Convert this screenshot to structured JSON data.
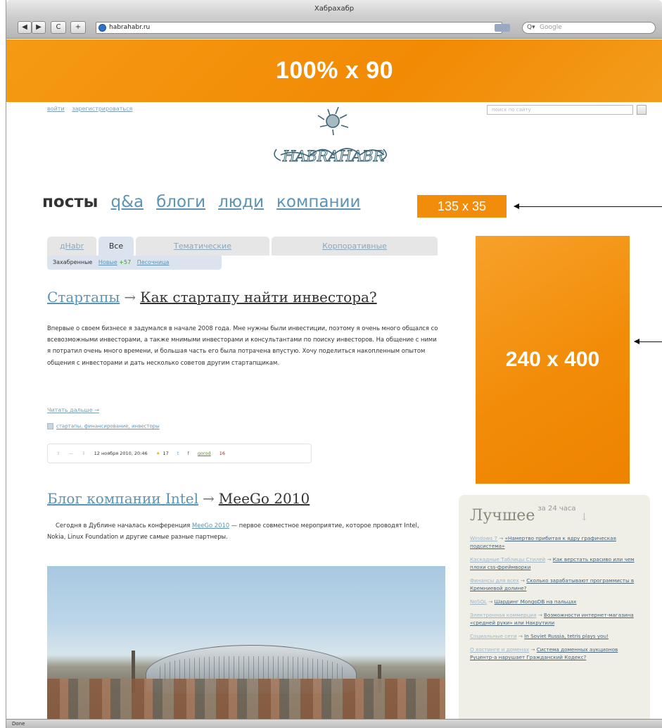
{
  "browser": {
    "title": "Хабрахабр",
    "url": "habrahabr.ru",
    "search_placeholder": "Google",
    "status": "Done",
    "back_label": "◀",
    "forward_label": "▶",
    "reload_label": "C",
    "add_label": "+"
  },
  "banners": {
    "top": "100% x 90",
    "nav": "135 x 35",
    "side": "240 x 400"
  },
  "header": {
    "login": "войти",
    "register": "зарегистрироваться",
    "site_search_placeholder": "поиск по сайту"
  },
  "nav": {
    "items": [
      "посты",
      "q&a",
      "блоги",
      "люди",
      "компании"
    ]
  },
  "tabs": {
    "items": [
      "дHabr",
      "Все",
      "Тематические",
      "Корпоративные"
    ]
  },
  "subtabs": {
    "current": "Захабренные",
    "new_label": "Новые",
    "new_count": "+57",
    "sandbox": "Песочница"
  },
  "posts": [
    {
      "hub": "Стартапы",
      "title": "Как стартапу найти инвестора?",
      "body": "Впервые о своем бизнесе я задумался в начале 2008 года. Мне нужны были инвестиции, поэтому я очень много общался со всевозможными инвесторами, а также мнимыми инвесторами и консультантами по поиску инвесторов. На общение с ними я потратил очень много времени, и большая часть его была потрачена впустую. Хочу поделиться накопленным опытом общения с инвесторами и дать несколько советов другим стартапщикам.",
      "read_more": "Читать дальше →",
      "tags": "стартапы, финансирование, инвесторы",
      "date": "12 ноября 2010, 20:46",
      "favs": "17",
      "author": "gorod",
      "comments": "16"
    },
    {
      "hub": "Блог компании Intel",
      "title": "MeeGo 2010",
      "body_before": "Сегодня в Дублине началась конференция ",
      "body_link": "MeeGo 2010",
      "body_after": " — первое совместное мероприятие, которое проводят Intel, Nokia, Linux Foundation и другие самые разные партнеры."
    }
  ],
  "best": {
    "title": "Лучшее",
    "period": "за 24 часа",
    "items": [
      {
        "hub": "Windows 7",
        "title": "«Намертво прибитая к ядру графическая подсистема»"
      },
      {
        "hub": "Каскадные Таблицы Стилей",
        "title": "Как верстать красиво или чем плохи css-фреймворки"
      },
      {
        "hub": "Финансы для всех",
        "title": "Сколько зарабатывают программисты в Кремниевой долине?"
      },
      {
        "hub": "NoSQL",
        "title": "Шардинг MongoDB на пальцах"
      },
      {
        "hub": "Электронная коммерция",
        "title": "Возможности интернет-магазина «средней руки» или Накрутили"
      },
      {
        "hub": "Социальные сети",
        "title": "In Soviet Russia, tetris plays you!"
      },
      {
        "hub": "О хостинге и доменах",
        "title": "Система доменных аукционов Руцентр-а нарушает Гражданский Кодекс?"
      }
    ]
  }
}
